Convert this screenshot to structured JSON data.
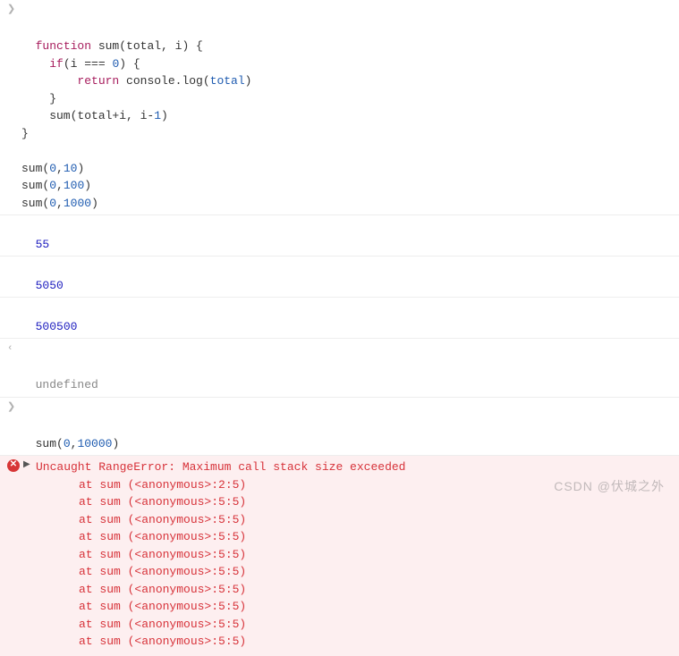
{
  "input1": {
    "line1": {
      "kw1": "function",
      "name": " sum(total, i) {"
    },
    "line2": {
      "prefix": "    ",
      "kw": "if",
      "rest": "(i === ",
      "num": "0",
      "tail": ") {"
    },
    "line3": {
      "prefix": "        ",
      "kw": "return",
      "mid": " console.log(",
      "arg": "total",
      "tail": ")"
    },
    "line4": "    }",
    "line5": {
      "prefix": "    sum(total+i, i-",
      "num": "1",
      "tail": ")"
    },
    "line6": "}",
    "blank": "",
    "call1": {
      "fn": "sum(",
      "a": "0",
      "c": ",",
      "b": "10",
      "end": ")"
    },
    "call2": {
      "fn": "sum(",
      "a": "0",
      "c": ",",
      "b": "100",
      "end": ")"
    },
    "call3": {
      "fn": "sum(",
      "a": "0",
      "c": ",",
      "b": "1000",
      "end": ")"
    }
  },
  "outputs": [
    "55",
    "5050",
    "500500"
  ],
  "return1": "undefined",
  "input2": {
    "fn": "sum(",
    "a": "0",
    "c": ",",
    "b": "10000",
    "end": ")"
  },
  "error": {
    "message": "Uncaught RangeError: Maximum call stack size exceeded",
    "trace": [
      "at sum (<anonymous>:2:5)",
      "at sum (<anonymous>:5:5)",
      "at sum (<anonymous>:5:5)",
      "at sum (<anonymous>:5:5)",
      "at sum (<anonymous>:5:5)",
      "at sum (<anonymous>:5:5)",
      "at sum (<anonymous>:5:5)",
      "at sum (<anonymous>:5:5)",
      "at sum (<anonymous>:5:5)",
      "at sum (<anonymous>:5:5)"
    ]
  },
  "watermark": "CSDN @伏城之外"
}
